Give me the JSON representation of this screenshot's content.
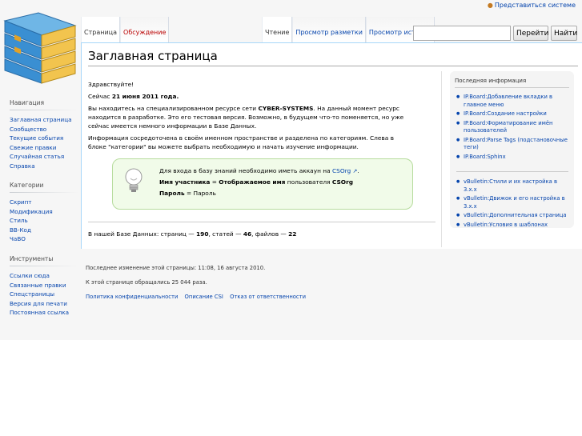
{
  "personal": {
    "login": "Представиться системе"
  },
  "tabs": {
    "left": [
      "Страница",
      "Обсуждение"
    ],
    "right": [
      "Чтение",
      "Просмотр разметки",
      "Просмотр истории"
    ]
  },
  "search": {
    "go": "Перейти",
    "find": "Найти",
    "value": ""
  },
  "page": {
    "title": "Заглавная страница"
  },
  "main": {
    "greeting": "Здравствуйте!",
    "date_prefix": "Сейчас ",
    "date_value": "21 июня 2011 года.",
    "p3_a": "Вы находитесь на специализированном ресурсе сети ",
    "p3_b": "CYBER-SYSTEMS",
    "p3_c": ". На данный момент ресурс находится в разработке. Это его тестовая версия. Возможно, в будущем что-то поменяется, но уже сейчас имеется немного информации в Базе Данных.",
    "p4": "Информация сосредоточена в своём именном пространстве и разделена по категориям. Слева в блоке \"категории\" вы можете выбрать необходимую и начать изучение информации."
  },
  "notice": {
    "line1_a": "Для входа в базу знаний необходимо иметь аккаун на ",
    "line1_link": "CSOrg",
    "line1_b": ".",
    "line2_a": "Имя участника",
    "line2_b": " = ",
    "line2_c": "Отображаемое имя",
    "line2_d": " пользователя ",
    "line2_e": "CSOrg",
    "line3_a": "Пароль",
    "line3_b": " = Пароль"
  },
  "stats": {
    "prefix": "В нашей Базе Данных: страниц — ",
    "pages": "190",
    "mid1": ", статей — ",
    "articles": "46",
    "mid2": ", файлов — ",
    "files": "22"
  },
  "info": {
    "title": "Последняя информация",
    "group1": [
      "IP.Board:Добавление вкладки в главное меню",
      "IP.Board:Создание настройки",
      "IP.Board:Форматирование имён пользователей",
      "IP.Board:Parse Tags (подстановочные теги)",
      "IP.Board:Sphinx"
    ],
    "group2": [
      "vBulletin:Стили и их настройка в 3.х.х",
      "vBulletin:Движок и его настройка в 3.х.х",
      "vBulletin:Дополнительная страница",
      "vBulletin:Условия в шаблонах"
    ]
  },
  "sidebar": {
    "nav": {
      "heading": "Навигация",
      "items": [
        "Заглавная страница",
        "Сообщество",
        "Текущие события",
        "Свежие правки",
        "Случайная статья",
        "Справка"
      ]
    },
    "categories": {
      "heading": "Категории",
      "items": [
        "Скрипт",
        "Модификация",
        "Стиль",
        "BB-Код",
        "ЧаВО"
      ]
    },
    "tools": {
      "heading": "Инструменты",
      "items": [
        "Ссылки сюда",
        "Связанные правки",
        "Спецстраницы",
        "Версия для печати",
        "Постоянная ссылка"
      ]
    }
  },
  "footer": {
    "lastmod": "Последнее изменение этой страницы: 11:08, 16 августа 2010.",
    "views": "К этой странице обращались 25 044 раза.",
    "links": [
      "Политика конфиденциальности",
      "Описание CSI",
      "Отказ от ответственности"
    ]
  }
}
